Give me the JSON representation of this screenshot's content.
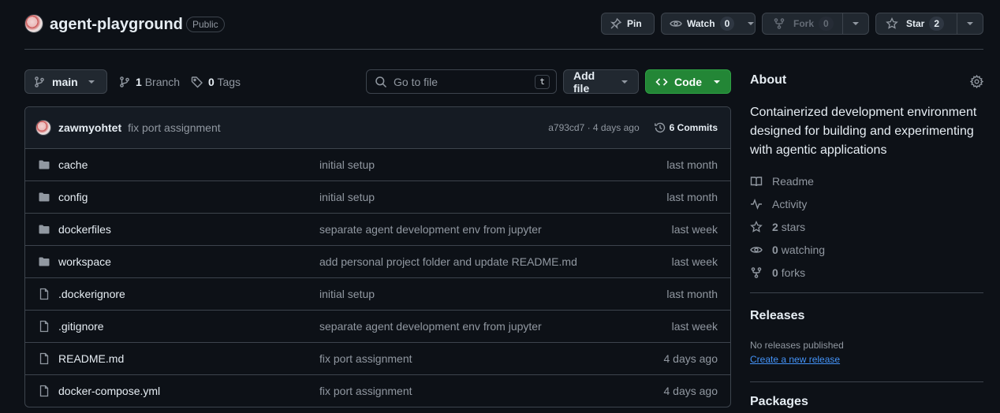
{
  "repo": {
    "name": "agent-playground",
    "visibility": "Public"
  },
  "header_actions": {
    "pin_label": "Pin",
    "watch_label": "Watch",
    "watch_count": "0",
    "fork_label": "Fork",
    "fork_count": "0",
    "star_label": "Star",
    "star_count": "2"
  },
  "toolbar": {
    "branch": "main",
    "branch_count": "1",
    "branch_word": "Branch",
    "tag_count": "0",
    "tag_word": "Tags",
    "search_placeholder": "Go to file",
    "search_shortcut": "t",
    "add_file_label": "Add file",
    "code_label": "Code"
  },
  "latest_commit": {
    "author": "zawmyohtet",
    "message": "fix port assignment",
    "meta": "a793cd7 · 4 days ago",
    "commits_label": "6 Commits"
  },
  "files": [
    {
      "type": "folder",
      "name": "cache",
      "message": "initial setup",
      "date": "last month"
    },
    {
      "type": "folder",
      "name": "config",
      "message": "initial setup",
      "date": "last month"
    },
    {
      "type": "folder",
      "name": "dockerfiles",
      "message": "separate agent development env from jupyter",
      "date": "last week"
    },
    {
      "type": "folder",
      "name": "workspace",
      "message": "add personal project folder and update README.md",
      "date": "last week"
    },
    {
      "type": "file",
      "name": ".dockerignore",
      "message": "initial setup",
      "date": "last month"
    },
    {
      "type": "file",
      "name": ".gitignore",
      "message": "separate agent development env from jupyter",
      "date": "last week"
    },
    {
      "type": "file",
      "name": "README.md",
      "message": "fix port assignment",
      "date": "4 days ago"
    },
    {
      "type": "file",
      "name": "docker-compose.yml",
      "message": "fix port assignment",
      "date": "4 days ago"
    }
  ],
  "about": {
    "title": "About",
    "description": "Containerized development environment designed for building and experimenting with agentic applications",
    "readme": "Readme",
    "activity": "Activity",
    "stars_count": "2",
    "stars_word": "stars",
    "watching_count": "0",
    "watching_word": "watching",
    "forks_count": "0",
    "forks_word": "forks"
  },
  "releases": {
    "title": "Releases",
    "empty_text": "No releases published",
    "create_link": "Create a new release"
  },
  "packages": {
    "title": "Packages"
  },
  "colors": {
    "background": "#0d1117",
    "border": "#3d444d",
    "muted_text": "#9198a1",
    "code_button": "#238636",
    "link": "#4493f8"
  }
}
